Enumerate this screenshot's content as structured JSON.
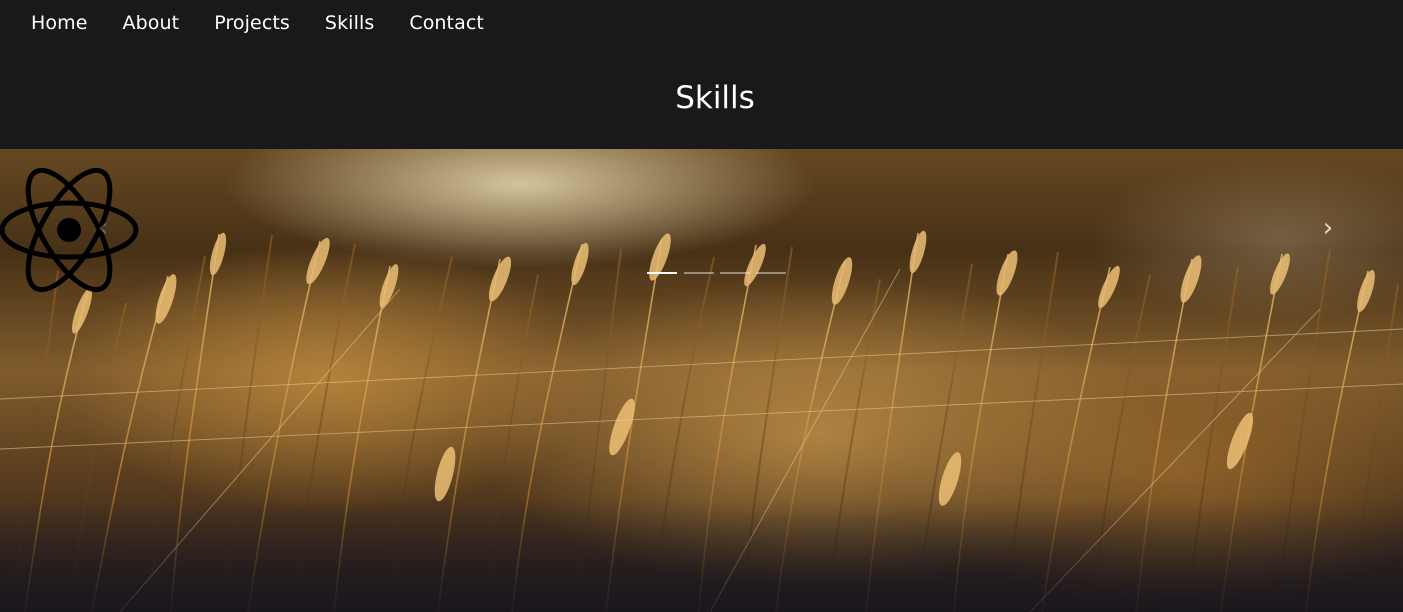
{
  "nav": {
    "items": [
      "Home",
      "About",
      "Projects",
      "Skills",
      "Contact"
    ]
  },
  "section": {
    "title": "Skills"
  },
  "carousel": {
    "slide_count": 4,
    "active_index": 0,
    "prev_icon": "chevron-left-icon",
    "next_icon": "chevron-right-icon",
    "logo_icon": "react-icon"
  },
  "colors": {
    "header": "#191919",
    "text": "#ffffff",
    "accent_gold": "#c89a4a"
  }
}
